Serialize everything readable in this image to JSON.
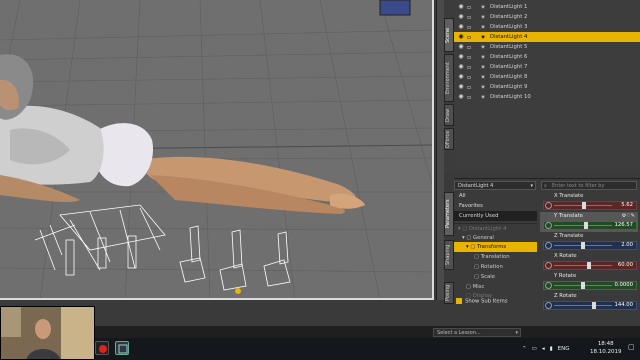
{
  "scene": {
    "items": [
      {
        "label": "DistantLight 1",
        "selected": false
      },
      {
        "label": "DistantLight 2",
        "selected": false
      },
      {
        "label": "DistantLight 3",
        "selected": false
      },
      {
        "label": "DistantLight 4",
        "selected": true
      },
      {
        "label": "DistantLight 5",
        "selected": false
      },
      {
        "label": "DistantLight 6",
        "selected": false
      },
      {
        "label": "DistantLight 7",
        "selected": false
      },
      {
        "label": "DistantLight 8",
        "selected": false
      },
      {
        "label": "DistantLight 9",
        "selected": false
      },
      {
        "label": "DistantLight 10",
        "selected": false
      }
    ]
  },
  "side_tabs": {
    "scene": "Scene",
    "environment": "Environment",
    "draw": "Draw",
    "dforce": "DForce",
    "parameters": "Parameters",
    "shaping": "Shaping",
    "posing": "Posing"
  },
  "parameters": {
    "node": "DistantLight 4",
    "search_placeholder": "Enter text to filter by",
    "filters": [
      "All",
      "Favorites",
      "Currently Used"
    ],
    "active_filter": "Currently Used",
    "tree": {
      "node": "DistantLight 4",
      "general": "General",
      "transforms": "Transforms",
      "translation": "Translation",
      "rotation": "Rotation",
      "scale": "Scale",
      "misc": "Misc",
      "display": "Display"
    },
    "show_sub_items": "Show Sub Items",
    "props": [
      {
        "name": "X Translate",
        "value": "5.62",
        "color": "red",
        "fill": 0.52
      },
      {
        "name": "Y Translate",
        "value": "126.57",
        "color": "green",
        "fill": 0.55,
        "selected": true
      },
      {
        "name": "Z Translate",
        "value": "2.00",
        "color": "blue",
        "fill": 0.5
      },
      {
        "name": "X Rotate",
        "value": "60.00",
        "color": "red",
        "fill": 0.62
      },
      {
        "name": "Y Rotate",
        "value": "0.0000",
        "color": "green",
        "fill": 0.5
      },
      {
        "name": "Z Rotate",
        "value": "144.00",
        "color": "blue",
        "fill": 0.7
      }
    ]
  },
  "lesson": {
    "placeholder": "Select a Lesson..."
  },
  "taskbar": {
    "language": "ENG",
    "time": "18:48",
    "date": "18.10.2019"
  },
  "colors": {
    "selection": "#e8b400",
    "viewport": "#6f6f6f",
    "panel": "#3a3a3a"
  }
}
